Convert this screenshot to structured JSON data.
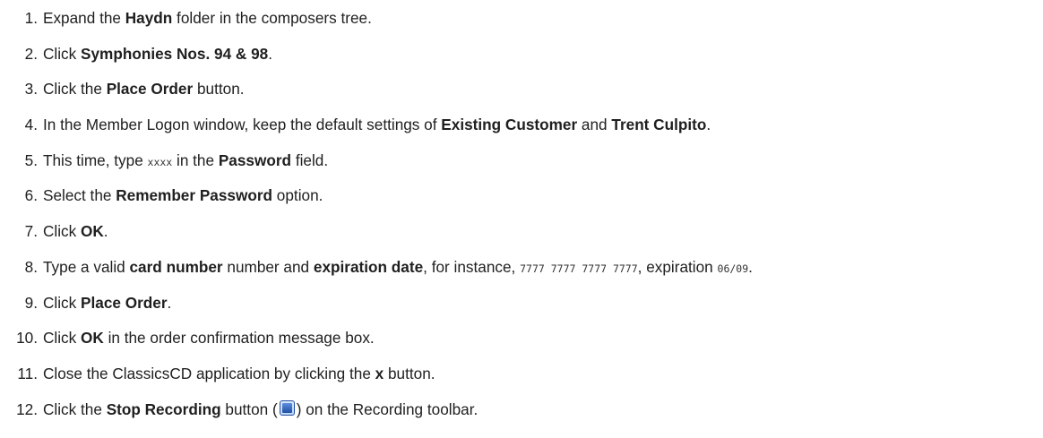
{
  "steps": [
    {
      "n": "1.",
      "a": "Expand the ",
      "b": "Haydn",
      "c": " folder in the composers tree."
    },
    {
      "n": "2.",
      "a": "Click ",
      "b": "Symphonies Nos. 94 & 98",
      "c": "."
    },
    {
      "n": "3.",
      "a": "Click the ",
      "b": "Place Order",
      "c": " button."
    },
    {
      "n": "4.",
      "a": "In the Member Logon window, keep the default settings of ",
      "b": "Existing Customer",
      "c": " and ",
      "d": "Trent Culpito",
      "e": "."
    },
    {
      "n": "5.",
      "a": "This time, type ",
      "code": "xxxx",
      "b": " in the ",
      "c": "Password",
      "d": " field."
    },
    {
      "n": "6.",
      "a": "Select the ",
      "b": "Remember Password",
      "c": " option."
    },
    {
      "n": "7.",
      "a": "Click ",
      "b": "OK",
      "c": "."
    },
    {
      "n": "8.",
      "a": "Type a valid ",
      "b": "card number",
      "c": " number and ",
      "d": "expiration date",
      "e": ", for instance, ",
      "code1": "7777 7777 7777 7777",
      "f": ", expiration ",
      "code2": "06/09",
      "g": "."
    },
    {
      "n": "9.",
      "a": "Click ",
      "b": "Place Order",
      "c": "."
    },
    {
      "n": "10.",
      "a": "Click ",
      "b": "OK",
      "c": " in the order confirmation message box."
    },
    {
      "n": "11.",
      "a": "Close the ClassicsCD application by clicking the ",
      "b": "x",
      "c": " button."
    },
    {
      "n": "12.",
      "a": "Click the ",
      "b": "Stop Recording",
      "c": " button (",
      "d": ") on the Recording toolbar."
    }
  ],
  "icons": {
    "stop_recording": "stop-recording-icon"
  },
  "colors": {
    "text": "#1f1f1f",
    "icon_blue": "#1d4fa3"
  }
}
